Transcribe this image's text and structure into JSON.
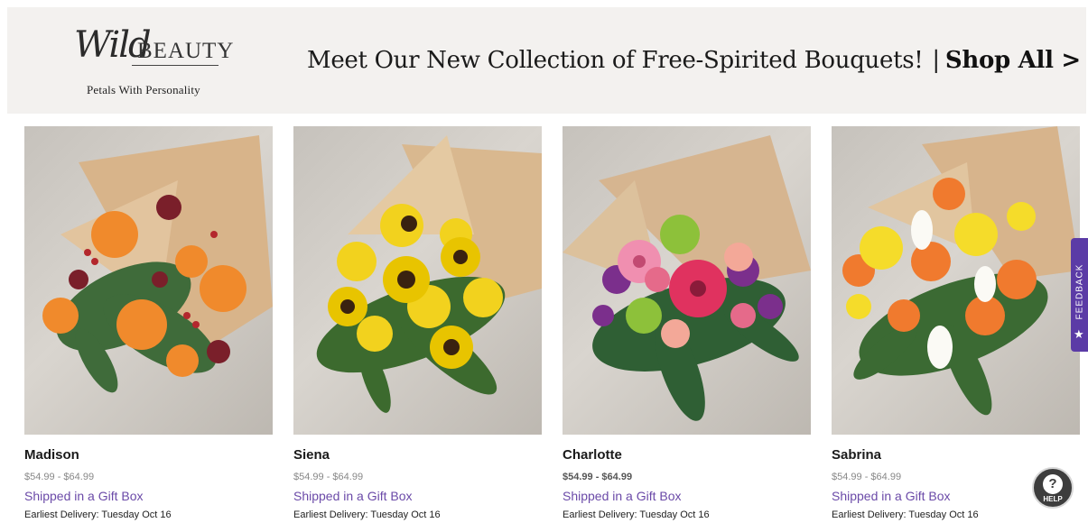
{
  "banner": {
    "logo": {
      "script": "Wild",
      "word": "BEAUTY",
      "tagline": "Petals With Personality"
    },
    "headline": "Meet Our New Collection of Free-Spirited Bouquets!",
    "separator": "|",
    "shop_all": "Shop All >"
  },
  "products": [
    {
      "name": "Madison",
      "price": "$54.99 - $64.99",
      "shipping": "Shipped in a Gift Box",
      "delivery": "Earliest Delivery: Tuesday Oct 16"
    },
    {
      "name": "Siena",
      "price": "$54.99 - $64.99",
      "shipping": "Shipped in a Gift Box",
      "delivery": "Earliest Delivery: Tuesday Oct 16"
    },
    {
      "name": "Charlotte",
      "price": "$54.99 - $64.99",
      "shipping": "Shipped in a Gift Box",
      "delivery": "Earliest Delivery: Tuesday Oct 16"
    },
    {
      "name": "Sabrina",
      "price": "$54.99 - $64.99",
      "shipping": "Shipped in a Gift Box",
      "delivery": "Earliest Delivery: Tuesday Oct 16"
    }
  ],
  "feedback": {
    "label": "FEEDBACK",
    "icon": "star-icon"
  },
  "help": {
    "label": "HELP",
    "glyph": "?",
    "icon": "question-icon"
  },
  "colors": {
    "accent": "#6b4aa8",
    "feedback_tab": "#5b3ba6",
    "banner_bg": "#f3f1ef"
  }
}
